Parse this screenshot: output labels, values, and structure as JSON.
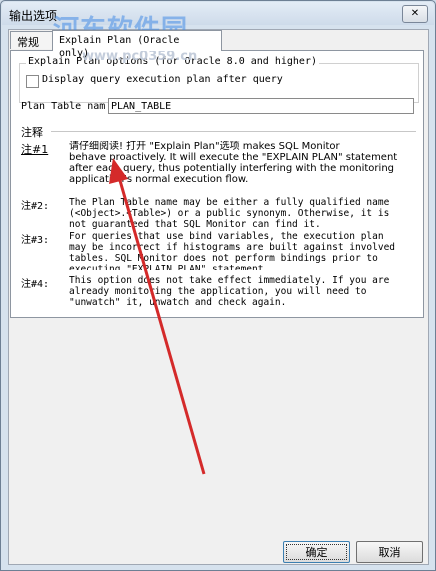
{
  "window": {
    "title": "输出选项",
    "close_label": "✕"
  },
  "watermark": {
    "text": "河东软件园",
    "url": "www.pc0359.cn"
  },
  "tabs": [
    {
      "label": "常规"
    },
    {
      "label": "Explain Plan (Oracle only)"
    }
  ],
  "explain_group": {
    "title": "Explain Plan options (for Oracle 8.0 and higher)",
    "checkbox_label": "Display query execution plan after query"
  },
  "plan_table": {
    "label": "Plan Table nam",
    "value": "PLAN_TABLE"
  },
  "notes": {
    "heading": "注释",
    "items": [
      {
        "key": "注#1",
        "text": "请仔细阅读! 打开 \"Explain Plan\"选项 makes SQL Monitor\nbehave proactively. It will execute the \"EXPLAIN PLAN\" statement\nafter each query, thus potentially interfering with the monitoring\napplication's normal execution flow."
      },
      {
        "key": "注#2:",
        "text": "The Plan Table name may be either a fully qualified name\n(<Object>.<Table>) or a public synonym. Otherwise, it is\nnot guaranteed that SQL Monitor can find it."
      },
      {
        "key": "注#3:",
        "text": "For queries that use bind variables, the execution plan\nmay be incorrect if histograms are built against involved\ntables. SQL Monitor does not perform bindings prior to\nexecuting \"EXPLAIN PLAN\" statement."
      },
      {
        "key": "注#4:",
        "text": "This option does not take effect immediately. If you are\nalready monitoring the application, you will need to\n\"unwatch\" it, unwatch and check again."
      }
    ]
  },
  "buttons": {
    "ok": "确定",
    "cancel": "取消"
  },
  "colors": {
    "arrow": "#d42a2a",
    "watermark": "#468ce6"
  }
}
